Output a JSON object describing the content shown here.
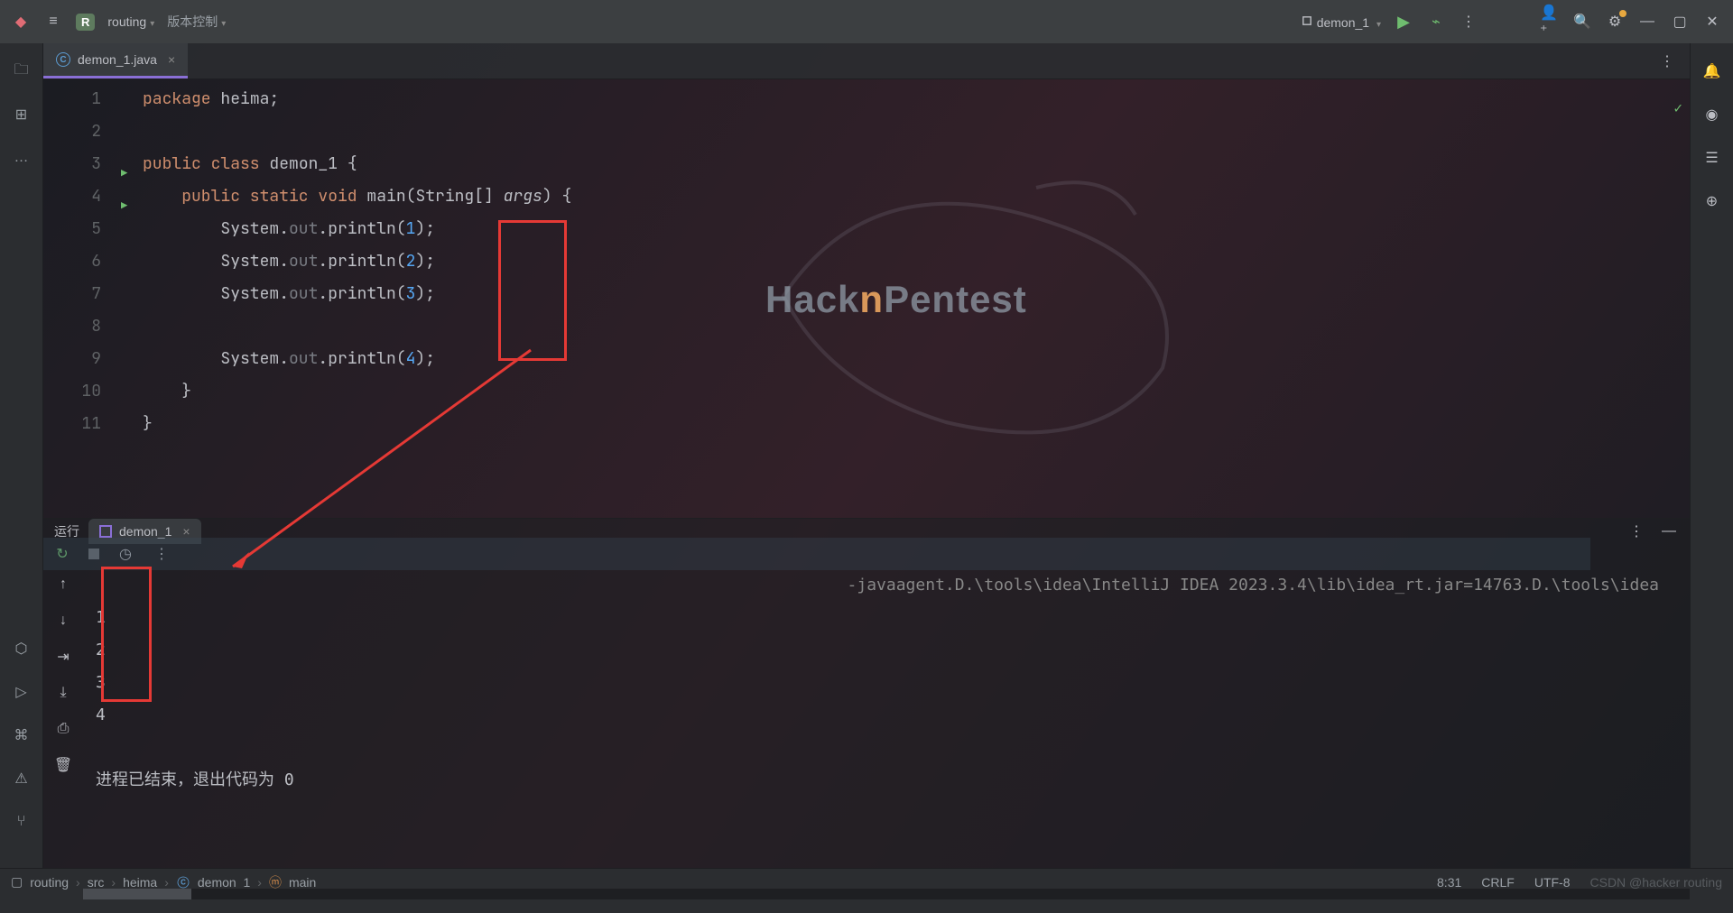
{
  "titlebar": {
    "project_badge": "R",
    "project_name": "routing",
    "vcs_label": "版本控制",
    "run_config": "demon_1"
  },
  "tabs": {
    "file_name": "demon_1.java"
  },
  "code": {
    "lines": [
      {
        "n": 1,
        "html": "<span class='kw'>package</span> <span class='cls'>heima</span>;"
      },
      {
        "n": 2,
        "html": ""
      },
      {
        "n": 3,
        "html": "<span class='kw'>public class</span> <span class='cls'>demon_1</span> {",
        "run": true
      },
      {
        "n": 4,
        "html": "    <span class='kw'>public static void</span> <span class='cls'>main</span>(<span class='cls'>String</span>[] <span class='param'>args</span>) {",
        "run": true
      },
      {
        "n": 5,
        "html": "        System.<span class='dim'>out</span>.println(<span class='num'>1</span>);"
      },
      {
        "n": 6,
        "html": "        System.<span class='dim'>out</span>.println(<span class='num'>2</span>);"
      },
      {
        "n": 7,
        "html": "        System.<span class='dim'>out</span>.println(<span class='num'>3</span>);"
      },
      {
        "n": 8,
        "html": "        System.<span class='dim'>out</span>.println(<span class='num'>4</span>);",
        "hl": true
      },
      {
        "n": 9,
        "html": "    }"
      },
      {
        "n": 10,
        "html": "}"
      },
      {
        "n": 11,
        "html": ""
      }
    ]
  },
  "run": {
    "label": "运行",
    "tab": "demon_1",
    "agent_line": "-javaagent.D.\\tools\\idea\\IntelliJ IDEA 2023.3.4\\lib\\idea_rt.jar=14763.D.\\tools\\idea",
    "output": [
      "1",
      "2",
      "3",
      "4"
    ],
    "exit": "进程已结束，退出代码为 0"
  },
  "status": {
    "crumbs": [
      "routing",
      "src",
      "heima",
      "demon_1",
      "main"
    ],
    "pos": "8:31",
    "eol": "CRLF",
    "enc": "UTF-8",
    "watermark": "CSDN @hacker routing"
  },
  "watermark": {
    "a": "Hack",
    "b": "n",
    "c": "Pentest"
  }
}
